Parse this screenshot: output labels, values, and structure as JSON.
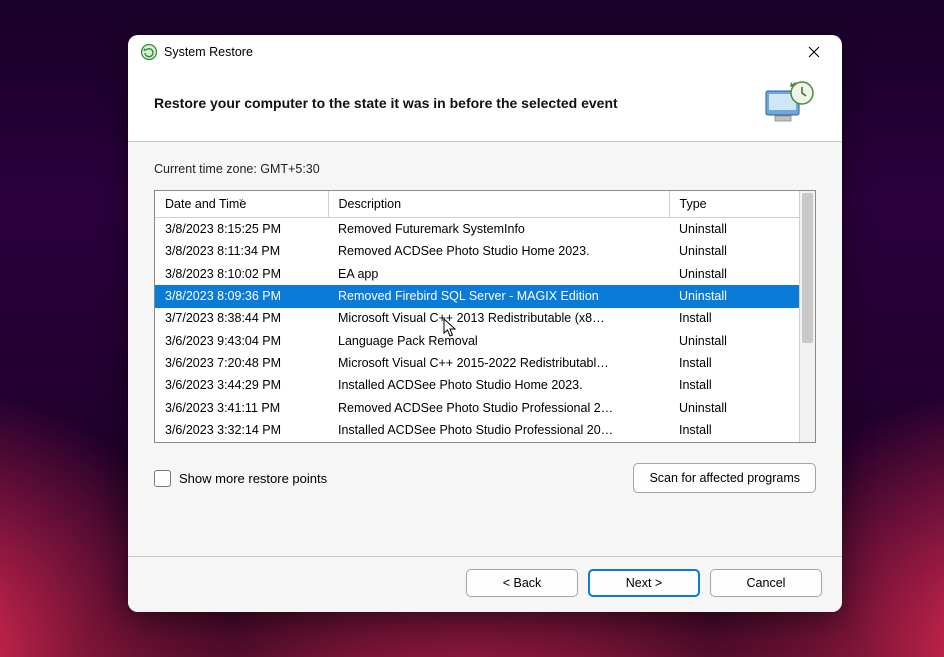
{
  "window": {
    "title": "System Restore"
  },
  "header": {
    "heading": "Restore your computer to the state it was in before the selected event"
  },
  "timezone_line": "Current time zone: GMT+5:30",
  "columns": {
    "datetime": "Date and Time",
    "description": "Description",
    "type": "Type"
  },
  "selected_index": 3,
  "rows": [
    {
      "dt": "3/8/2023 8:15:25 PM",
      "desc": "Removed Futuremark SystemInfo",
      "type": "Uninstall"
    },
    {
      "dt": "3/8/2023 8:11:34 PM",
      "desc": "Removed ACDSee Photo Studio Home 2023.",
      "type": "Uninstall"
    },
    {
      "dt": "3/8/2023 8:10:02 PM",
      "desc": "EA app",
      "type": "Uninstall"
    },
    {
      "dt": "3/8/2023 8:09:36 PM",
      "desc": "Removed Firebird SQL Server - MAGIX Edition",
      "type": "Uninstall"
    },
    {
      "dt": "3/7/2023 8:38:44 PM",
      "desc": "Microsoft Visual C++ 2013 Redistributable (x8…",
      "type": "Install"
    },
    {
      "dt": "3/6/2023 9:43:04 PM",
      "desc": "Language Pack Removal",
      "type": "Uninstall"
    },
    {
      "dt": "3/6/2023 7:20:48 PM",
      "desc": "Microsoft Visual C++ 2015-2022 Redistributabl…",
      "type": "Install"
    },
    {
      "dt": "3/6/2023 3:44:29 PM",
      "desc": "Installed ACDSee Photo Studio Home 2023.",
      "type": "Install"
    },
    {
      "dt": "3/6/2023 3:41:11 PM",
      "desc": "Removed ACDSee Photo Studio Professional 2…",
      "type": "Uninstall"
    },
    {
      "dt": "3/6/2023 3:32:14 PM",
      "desc": "Installed ACDSee Photo Studio Professional 20…",
      "type": "Install"
    }
  ],
  "show_more_label": "Show more restore points",
  "scan_label": "Scan for affected programs",
  "buttons": {
    "back": "< Back",
    "next": "Next >",
    "cancel": "Cancel"
  }
}
